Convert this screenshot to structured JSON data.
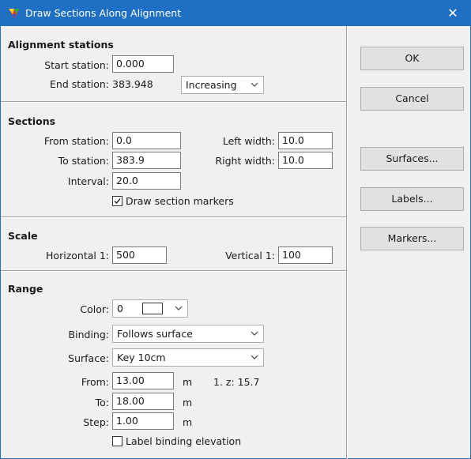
{
  "window": {
    "title": "Draw Sections Along Alignment",
    "close_label": "✕"
  },
  "alignment": {
    "title": "Alignment stations",
    "start_label": "Start station:",
    "start_value": "0.000",
    "end_label": "End station:",
    "end_value": "383.948",
    "direction": "Increasing"
  },
  "sections": {
    "title": "Sections",
    "from_label": "From station:",
    "from_value": "0.0",
    "to_label": "To station:",
    "to_value": "383.9",
    "interval_label": "Interval:",
    "interval_value": "20.0",
    "left_label": "Left width:",
    "left_value": "10.0",
    "right_label": "Right width:",
    "right_value": "10.0",
    "markers_label": "Draw section markers",
    "markers_checked": true
  },
  "scale": {
    "title": "Scale",
    "horizontal_label": "Horizontal 1:",
    "horizontal_value": "500",
    "vertical_label": "Vertical 1:",
    "vertical_value": "100"
  },
  "range": {
    "title": "Range",
    "color_label": "Color:",
    "color_value": "0",
    "binding_label": "Binding:",
    "binding_value": "Follows surface",
    "surface_label": "Surface:",
    "surface_value": "Key 10cm",
    "from_label": "From:",
    "from_value": "13.00",
    "from_unit": "m",
    "z_readout": "1. z:  15.7",
    "to_label": "To:",
    "to_value": "18.00",
    "to_unit": "m",
    "step_label": "Step:",
    "step_value": "1.00",
    "step_unit": "m",
    "label_binding": "Label binding elevation",
    "label_binding_checked": false
  },
  "buttons": {
    "ok": "OK",
    "cancel": "Cancel",
    "surfaces": "Surfaces...",
    "labels": "Labels...",
    "markers": "Markers..."
  },
  "colors": {
    "titlebar": "#1f6fc4",
    "dialog_bg": "#f0f0f0"
  }
}
